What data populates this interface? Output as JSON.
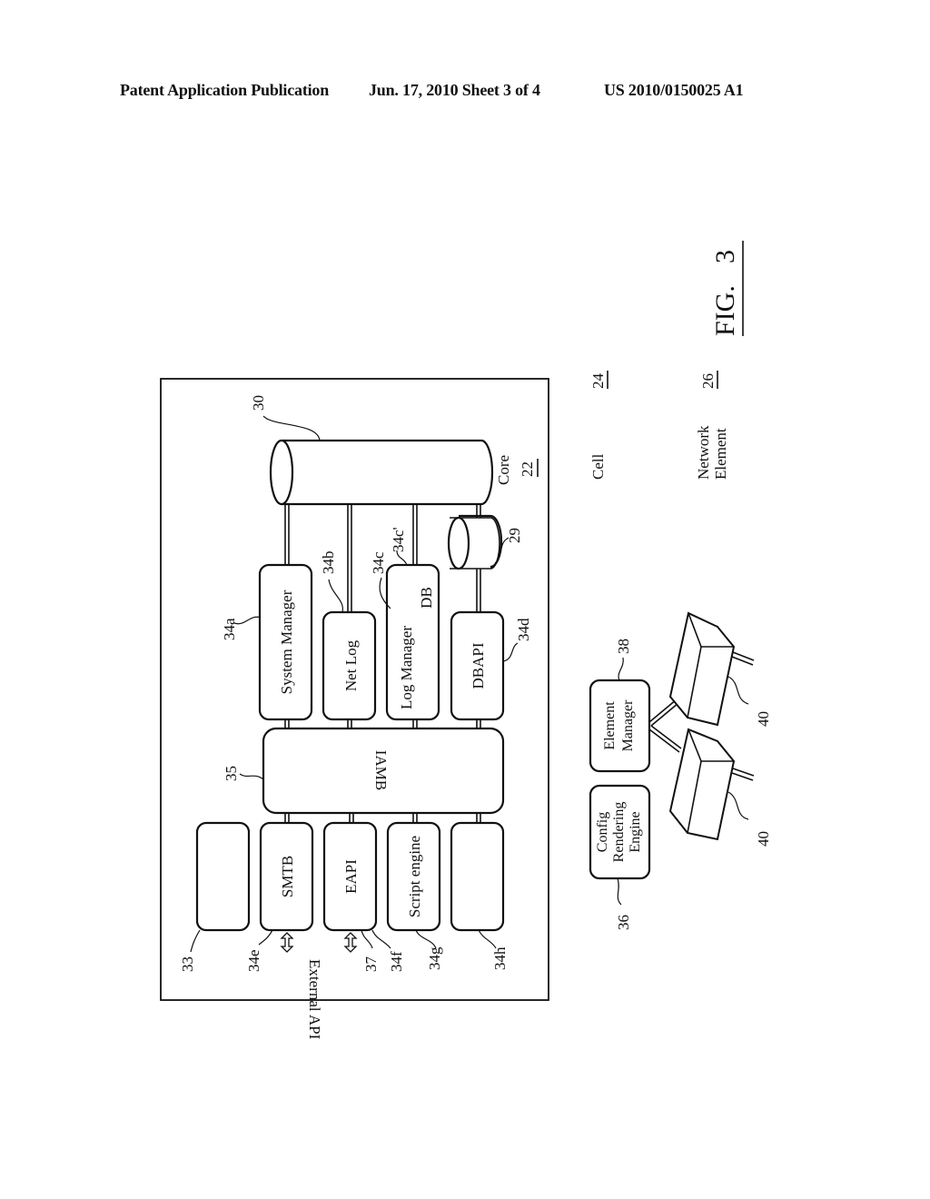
{
  "header": {
    "publication": "Patent Application Publication",
    "date_sheet": "Jun. 17, 2010  Sheet 3 of 4",
    "patent_number": "US 2010/0150025 A1"
  },
  "figure": {
    "label": "FIG.",
    "number": "3"
  },
  "core": {
    "label": "Core",
    "ref": "22",
    "bus_ref": "30",
    "small_db_ref": "29"
  },
  "top_modules": [
    {
      "label": "System Manager",
      "ref": "34a"
    },
    {
      "label": "Net Log",
      "ref": "34b"
    },
    {
      "label": "Log Manager",
      "ref": "34c",
      "sub_label": "DB",
      "sub_ref": "34c'"
    },
    {
      "label": "DBAPI",
      "ref": "34d"
    }
  ],
  "iamb": {
    "label": "IAMB",
    "ref": "35"
  },
  "bottom_modules": [
    {
      "label": "",
      "ref": "33"
    },
    {
      "label": "SMTB",
      "ref": "34e"
    },
    {
      "label": "EAPI",
      "ref": "34f"
    },
    {
      "label": "Script engine",
      "ref": "34g"
    },
    {
      "label": "",
      "ref": "34h"
    }
  ],
  "external_api": {
    "label": "External API",
    "ref": "37"
  },
  "legend": {
    "cell": {
      "label": "Cell",
      "ref": "24"
    },
    "network_element": {
      "label_line1": "Network",
      "label_line2": "Element",
      "ref": "26"
    }
  },
  "element_manager": {
    "label_line1": "Element",
    "label_line2": "Manager",
    "ref": "38"
  },
  "config_engine": {
    "label_line1": "Config",
    "label_line2": "Rendering",
    "label_line3": "Engine",
    "ref": "36"
  },
  "network_devices": [
    {
      "ref": "40"
    },
    {
      "ref": "40"
    }
  ]
}
